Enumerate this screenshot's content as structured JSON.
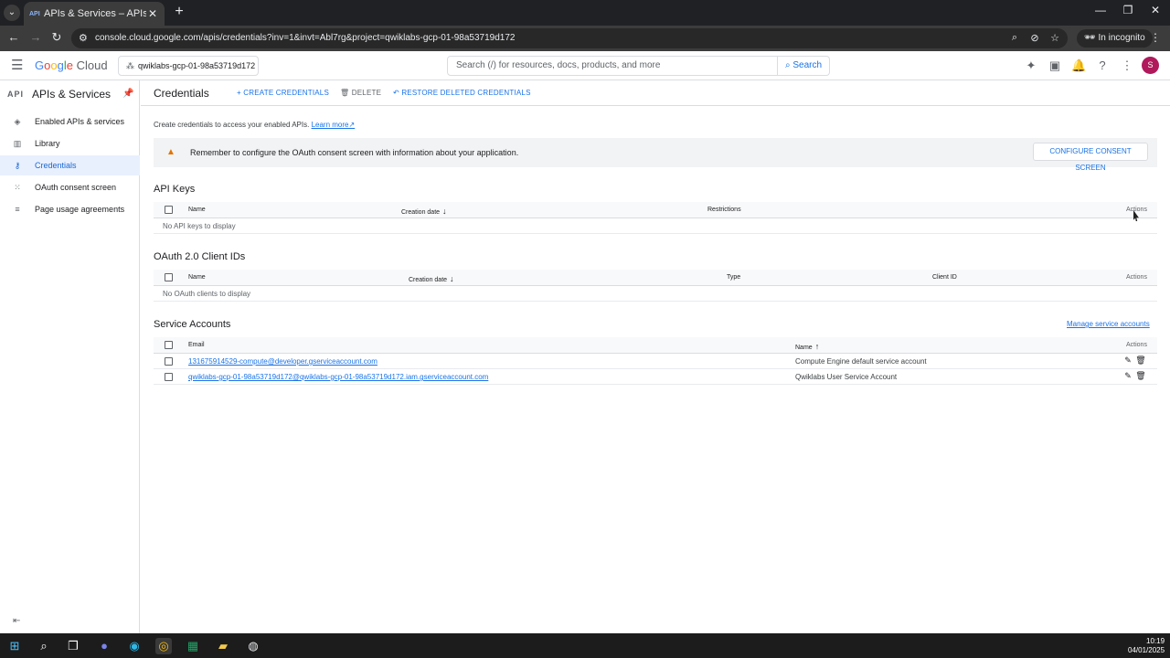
{
  "browser": {
    "tab_title": "APIs & Services – APIs & Servic",
    "tab_favicon": "API",
    "url": "console.cloud.google.com/apis/credentials?inv=1&invt=Abl7rg&project=qwiklabs-gcp-01-98a53719d172",
    "incognito_label": "In incognito"
  },
  "header": {
    "logo_google": [
      "G",
      "o",
      "o",
      "g",
      "l",
      "e"
    ],
    "logo_cloud": "Cloud",
    "project": "qwiklabs-gcp-01-98a53719d172",
    "search_placeholder": "Search (/) for resources, docs, products, and more",
    "search_button": "Search",
    "avatar_letter": "S"
  },
  "sidebar": {
    "badge": "API",
    "title": "APIs & Services",
    "items": [
      {
        "label": "Enabled APIs & services",
        "icon": "diamond-icon"
      },
      {
        "label": "Library",
        "icon": "library-icon"
      },
      {
        "label": "Credentials",
        "icon": "key-icon"
      },
      {
        "label": "OAuth consent screen",
        "icon": "consent-icon"
      },
      {
        "label": "Page usage agreements",
        "icon": "settings-list-icon"
      }
    ]
  },
  "toolbar": {
    "title": "Credentials",
    "create": "CREATE CREDENTIALS",
    "delete": "DELETE",
    "restore": "RESTORE DELETED CREDENTIALS"
  },
  "intro": {
    "text": "Create credentials to access your enabled APIs.",
    "learn_more": "Learn more"
  },
  "banner": {
    "message": "Remember to configure the OAuth consent screen with information about your application.",
    "button": "CONFIGURE CONSENT SCREEN"
  },
  "api_keys": {
    "title": "API Keys",
    "columns": [
      "Name",
      "Creation date",
      "Restrictions",
      "Actions"
    ],
    "empty": "No API keys to display"
  },
  "oauth": {
    "title": "OAuth 2.0 Client IDs",
    "columns": [
      "Name",
      "Creation date",
      "Type",
      "Client ID",
      "Actions"
    ],
    "empty": "No OAuth clients to display"
  },
  "service_accounts": {
    "title": "Service Accounts",
    "manage_link": "Manage service accounts",
    "columns": [
      "Email",
      "Name",
      "Actions"
    ],
    "rows": [
      {
        "email": "131675914529-compute@developer.gserviceaccount.com",
        "name": "Compute Engine default service account"
      },
      {
        "email": "qwiklabs-gcp-01-98a53719d172@qwiklabs-gcp-01-98a53719d172.iam.gserviceaccount.com",
        "name": "Qwiklabs User Service Account"
      }
    ]
  },
  "taskbar": {
    "time": "10:19",
    "date": "04/01/2025"
  }
}
